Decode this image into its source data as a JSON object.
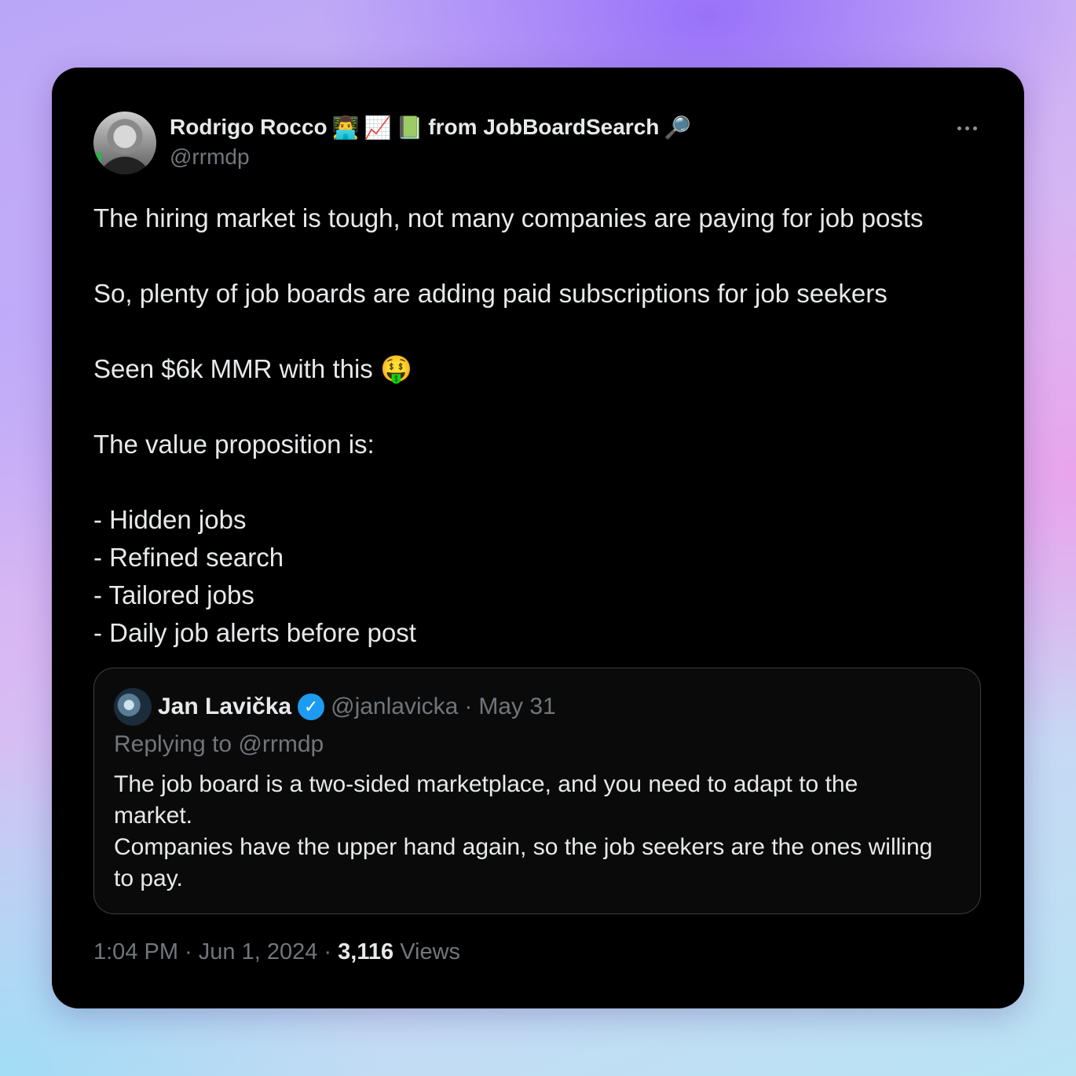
{
  "tweet": {
    "author": {
      "name": "Rodrigo Rocco",
      "emojis": [
        "👨‍💻",
        "📈",
        "📗"
      ],
      "name_suffix": "from JobBoardSearch",
      "suffix_emoji": "🔎",
      "handle": "@rrmdp"
    },
    "more_label": "More",
    "text_lines": [
      "The hiring market is tough, not many companies are paying for job posts",
      "",
      "So, plenty of job boards are adding paid subscriptions for job seekers",
      "",
      "Seen $6k MMR with this 🤑",
      "",
      "The value proposition is:",
      "",
      "- Hidden jobs",
      "- Refined search",
      "- Tailored jobs",
      "- Daily job alerts before post"
    ],
    "quote": {
      "name": "Jan Lavička",
      "verified_mark": "✓",
      "handle": "@janlavicka",
      "separator": "·",
      "date": "May 31",
      "replying_to": "Replying to @rrmdp",
      "text_lines": [
        "The job board is a two-sided marketplace, and you need to adapt to the",
        "market.",
        "Companies have the upper hand again, so the job seekers are the ones willing",
        "to pay."
      ]
    },
    "footer": {
      "timestamp": "1:04 PM · Jun 1, 2024",
      "separator": "·",
      "views_count": "3,116",
      "views_label": "Views"
    }
  },
  "colors": {
    "card_bg": "#000000",
    "text_primary": "#e7e9ea",
    "text_secondary": "#71767b",
    "verified_blue": "#1d9bf0"
  }
}
